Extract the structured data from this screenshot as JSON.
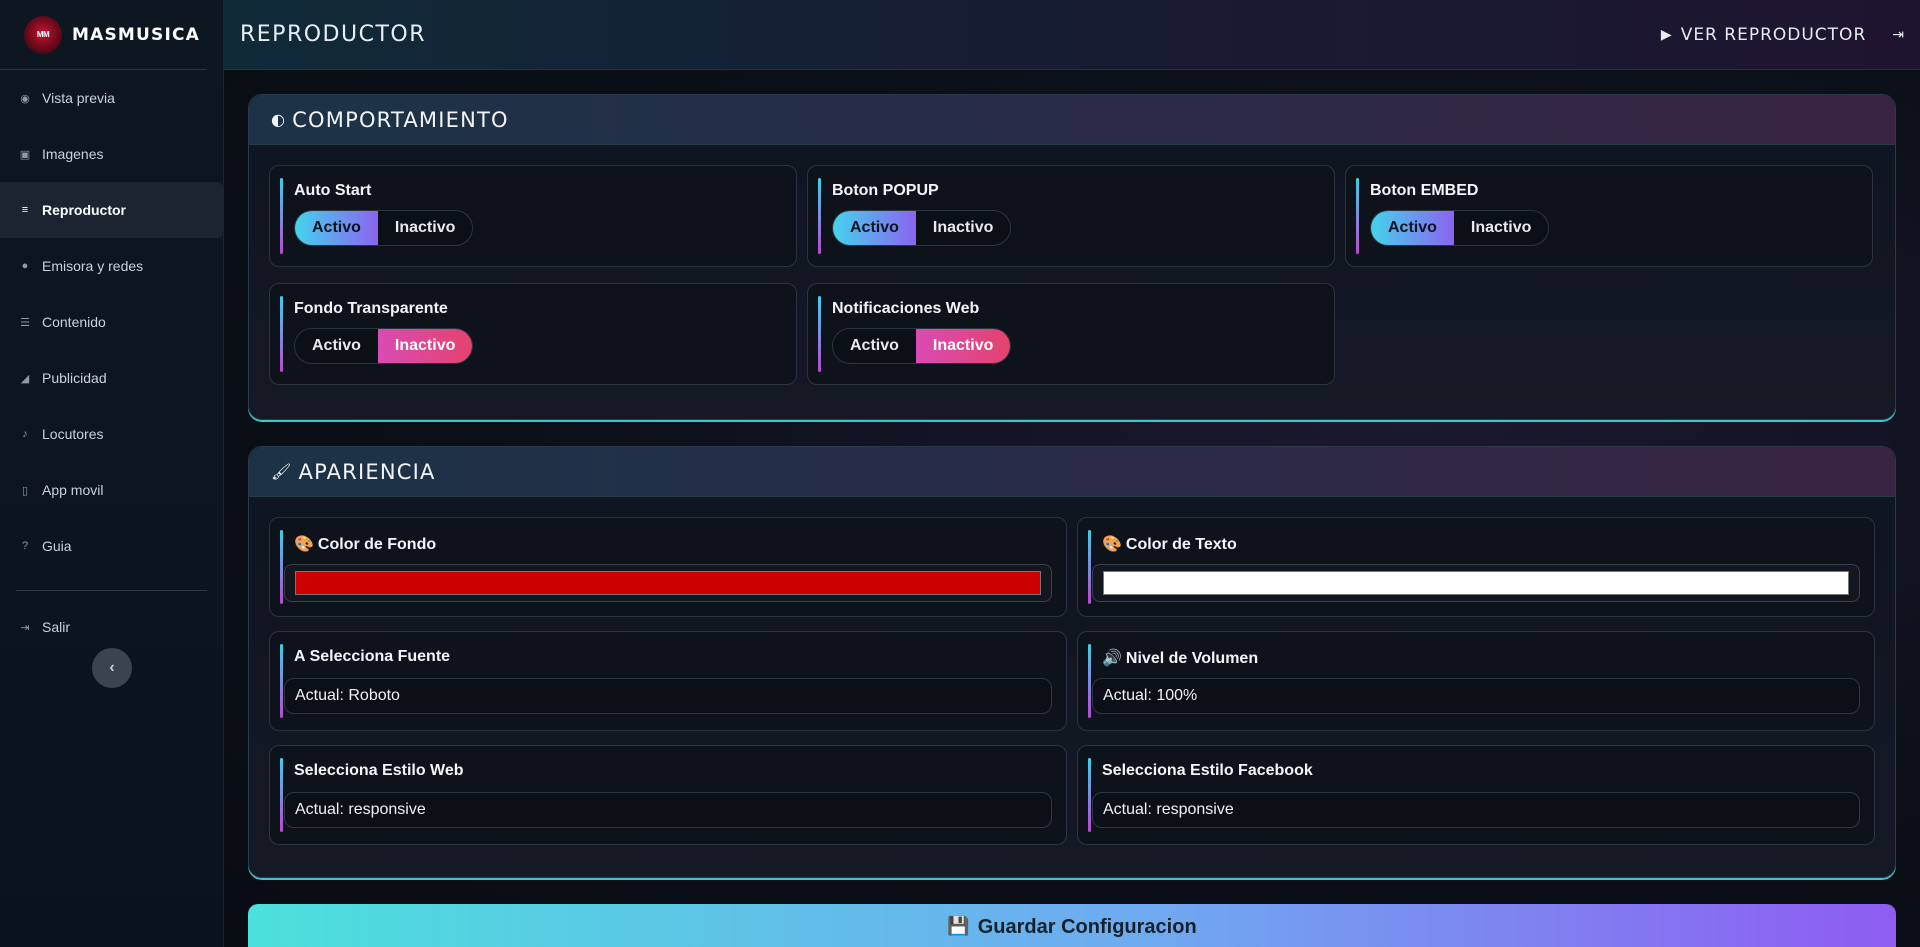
{
  "brand": {
    "logo_text": "MM",
    "name": "MASMUSICA"
  },
  "sidebar": {
    "items": [
      {
        "label": "Vista previa",
        "icon": "eye-icon",
        "glyph": "◉"
      },
      {
        "label": "Imagenes",
        "icon": "image-icon",
        "glyph": "▣"
      },
      {
        "label": "Reproductor",
        "icon": "sliders-icon",
        "glyph": "≡",
        "active": true
      },
      {
        "label": "Emisora y redes",
        "icon": "globe-icon",
        "glyph": "●"
      },
      {
        "label": "Contenido",
        "icon": "list-icon",
        "glyph": "☰"
      },
      {
        "label": "Publicidad",
        "icon": "bullhorn-icon",
        "glyph": "◢"
      },
      {
        "label": "Locutores",
        "icon": "microphone-icon",
        "glyph": "♪"
      },
      {
        "label": "App movil",
        "icon": "mobile-icon",
        "glyph": "▯"
      },
      {
        "label": "Guia",
        "icon": "question-icon",
        "glyph": "?"
      }
    ],
    "logout": {
      "label": "Salir",
      "icon": "sign-out-icon",
      "glyph": "⇥"
    },
    "collapse_glyph": "‹"
  },
  "header": {
    "title": "REPRODUCTOR",
    "view_player_label": "VER REPRODUCTOR",
    "play_glyph": "▶",
    "logout_glyph": "⇥"
  },
  "behavior": {
    "title": "COMPORTAMIENTO",
    "icon": "toggle-icon",
    "toggles": [
      {
        "label": "Auto Start",
        "active_label": "Activo",
        "inactive_label": "Inactivo",
        "state": "Activo"
      },
      {
        "label": "Boton POPUP",
        "active_label": "Activo",
        "inactive_label": "Inactivo",
        "state": "Activo"
      },
      {
        "label": "Boton EMBED",
        "active_label": "Activo",
        "inactive_label": "Inactivo",
        "state": "Activo"
      },
      {
        "label": "Fondo Transparente",
        "active_label": "Activo",
        "inactive_label": "Inactivo",
        "state": "Inactivo"
      },
      {
        "label": "Notificaciones Web",
        "active_label": "Activo",
        "inactive_label": "Inactivo",
        "state": "Inactivo"
      }
    ]
  },
  "appearance": {
    "title": "APARIENCIA",
    "icon": "brush-icon",
    "background_color": {
      "label": "Color de Fondo",
      "value": "#cc0000"
    },
    "text_color": {
      "label": "Color de Texto",
      "value": "#ffffff"
    },
    "font": {
      "label": "Selecciona Fuente",
      "value": "Actual: Roboto"
    },
    "volume": {
      "label": "Nivel de Volumen",
      "value": "Actual: 100%"
    },
    "web_style": {
      "label": "Selecciona Estilo Web",
      "value": "Actual: responsive"
    },
    "facebook_style": {
      "label": "Selecciona Estilo Facebook",
      "value": "Actual: responsive"
    }
  },
  "save_button": {
    "label": "Guardar Configuracion",
    "icon": "floppy-disk-icon"
  },
  "colors": {
    "accent_cyan": "#44d3ec",
    "accent_purple": "#8b63f0",
    "accent_pink": "#e4436e"
  }
}
